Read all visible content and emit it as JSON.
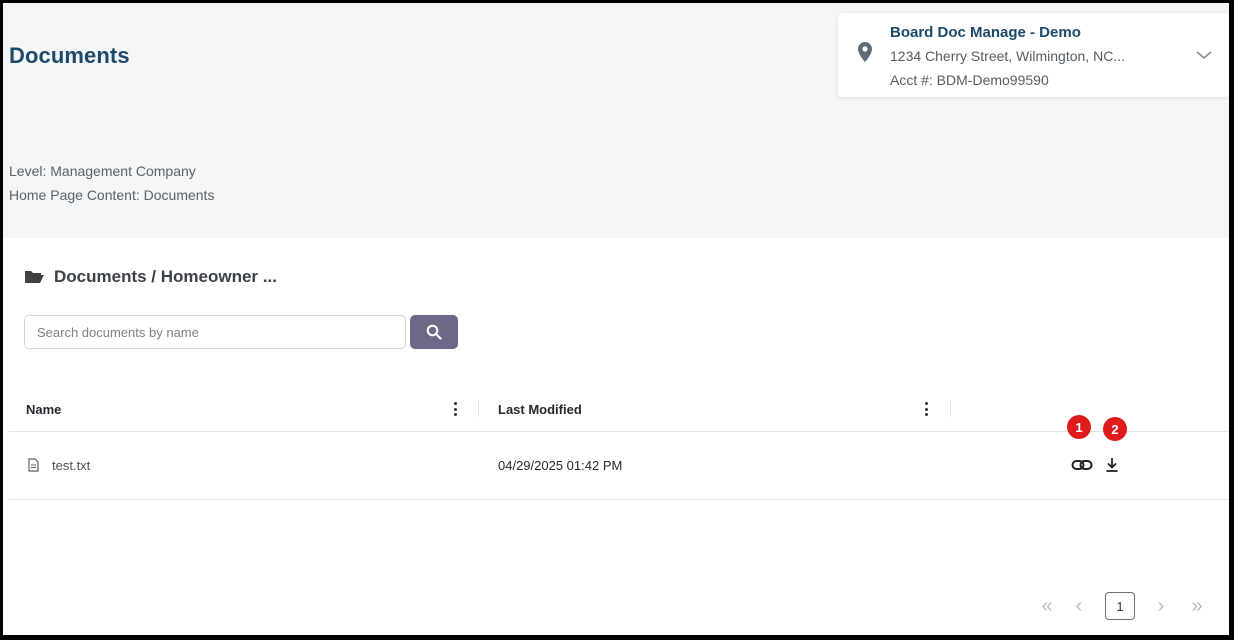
{
  "page": {
    "title": "Documents"
  },
  "account": {
    "name": "Board Doc Manage - Demo",
    "address": "1234 Cherry Street, Wilmington, NC...",
    "acct_number": "Acct #: BDM-Demo99590"
  },
  "info": {
    "level": "Level: Management Company",
    "home_content": "Home Page Content: Documents"
  },
  "breadcrumb": {
    "text": "Documents / Homeowner ..."
  },
  "search": {
    "placeholder": "Search documents by name",
    "value": ""
  },
  "table": {
    "columns": [
      "Name",
      "Last Modified"
    ],
    "rows": [
      {
        "name": "test.txt",
        "last_modified": "04/29/2025 01:42 PM"
      }
    ]
  },
  "annotations": {
    "badge_1": "1",
    "badge_2": "2"
  },
  "pagination": {
    "first": "«",
    "prev": "‹",
    "current": "1",
    "next": "›",
    "last": "»"
  },
  "icons": {
    "location": "map-pin-icon",
    "expand": "chevron-down-icon",
    "folder": "folder-open-icon",
    "search": "search-icon",
    "file": "file-text-icon",
    "link": "link-icon",
    "download": "download-icon"
  },
  "colors": {
    "title": "#1d4a6b",
    "search_button": "#6b6987",
    "badge": "#e01b1b",
    "top_background": "#f4f6f7"
  }
}
